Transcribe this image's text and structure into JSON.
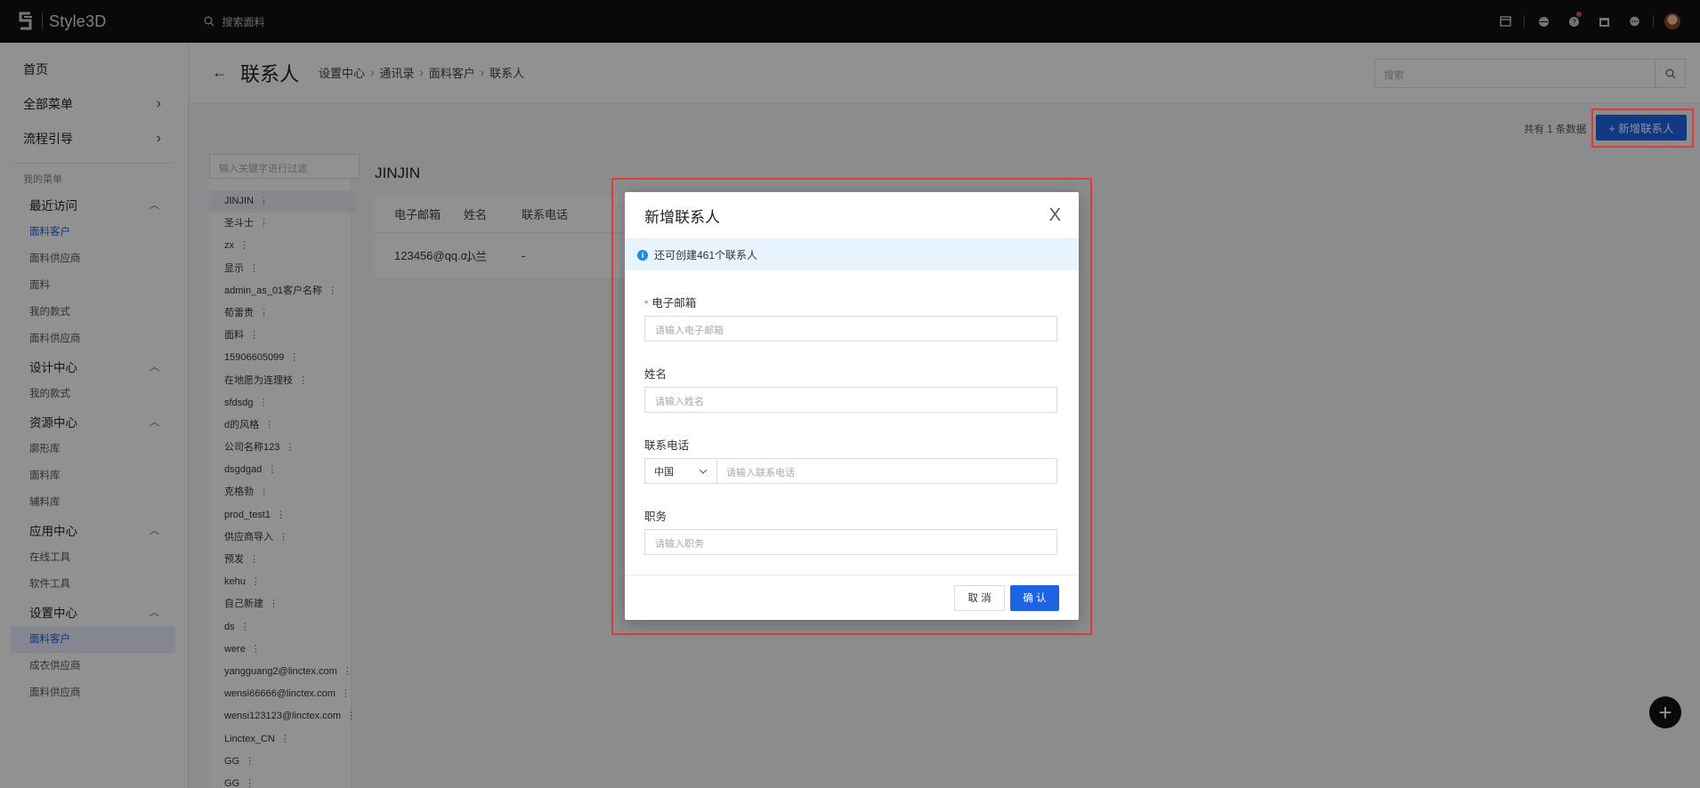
{
  "app": {
    "logo_text": "Style3D"
  },
  "topbar": {
    "search_placeholder": "搜索面料"
  },
  "sidebar": {
    "top_items": [
      {
        "label": "首页"
      },
      {
        "label": "全部菜单",
        "chevron": "›"
      },
      {
        "label": "流程引导",
        "chevron": "›"
      }
    ],
    "my_menu_caption": "我的菜单",
    "groups": [
      {
        "label": "最近访问",
        "items": [
          {
            "label": "面料客户",
            "state": "highlight"
          },
          {
            "label": "面料供应商"
          },
          {
            "label": "面料"
          },
          {
            "label": "我的款式"
          },
          {
            "label": "面料供应商"
          }
        ]
      },
      {
        "label": "设计中心",
        "items": [
          {
            "label": "我的款式"
          }
        ]
      },
      {
        "label": "资源中心",
        "items": [
          {
            "label": "廓形库"
          },
          {
            "label": "面料库"
          },
          {
            "label": "辅料库"
          }
        ]
      },
      {
        "label": "应用中心",
        "items": [
          {
            "label": "在线工具"
          },
          {
            "label": "软件工具"
          }
        ]
      },
      {
        "label": "设置中心",
        "items": [
          {
            "label": "面料客户",
            "state": "active"
          },
          {
            "label": "成衣供应商"
          },
          {
            "label": "面料供应商"
          }
        ]
      }
    ]
  },
  "header": {
    "back": "←",
    "title": "联系人",
    "breadcrumb": [
      "设置中心",
      "通讯录",
      "面料客户",
      "联系人"
    ],
    "breadcrumb_sep": "›",
    "search_placeholder": "搜索"
  },
  "toolbar": {
    "total_text": "共有 1 条数据",
    "add_button": "+ 新增联系人"
  },
  "list": {
    "filter_placeholder": "输入关键字进行过滤",
    "more_glyph": "⋮",
    "items": [
      "JINJIN",
      "圣斗士",
      "zx",
      "显示",
      "admin_as_01客户名称",
      "荀雷贵",
      "面料",
      "15906605099",
      "在地愿为连理枝",
      "sfdsdg",
      "d的风格",
      "公司名称123",
      "dsgdgad",
      "克格勃",
      "prod_test1",
      "供应商导入",
      "预发",
      "kehu",
      "自己新建",
      "ds",
      "were",
      "yangguang2@linctex.com",
      "wensi66666@linctex.com",
      "wensi123123@linctex.com",
      "Linctex_CN",
      "GG",
      "GG"
    ]
  },
  "table": {
    "title": "JINJIN",
    "headers": [
      "电子邮箱",
      "姓名",
      "联系电话"
    ],
    "rows": [
      [
        "123456@qq.c...",
        "小兰",
        "-"
      ]
    ]
  },
  "fab": {
    "label": "+"
  },
  "dialog": {
    "title": "新增联系人",
    "close": "X",
    "notice": "还可创建461个联系人",
    "fields": {
      "email": {
        "label": "电子邮箱",
        "required_mark": "*",
        "placeholder": "请输入电子邮箱"
      },
      "name": {
        "label": "姓名",
        "placeholder": "请输入姓名"
      },
      "phone": {
        "label": "联系电话",
        "country": "中国",
        "placeholder": "请输入联系电话"
      },
      "position": {
        "label": "职务",
        "placeholder": "请输入职务"
      }
    },
    "cancel": "取 消",
    "confirm": "确 认"
  },
  "colors": {
    "primary": "#1e63e6",
    "highlight_box": "#e03a3a",
    "info": "#1e88e5"
  }
}
